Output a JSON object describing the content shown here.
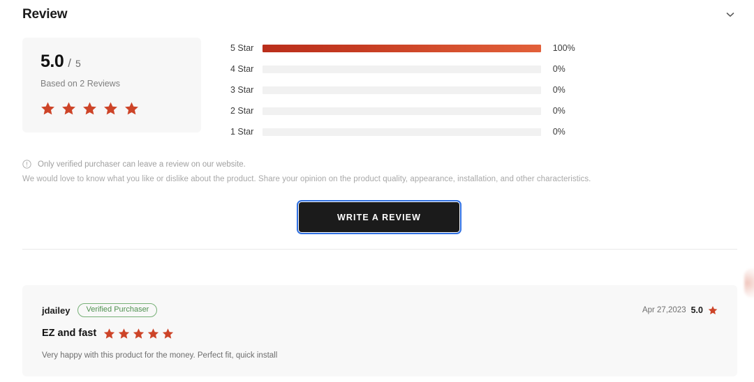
{
  "header": {
    "title": "Review",
    "collapse_icon": "chevron-down-icon"
  },
  "summary": {
    "score": "5.0",
    "separator": "/",
    "max_score": "5",
    "based_on": "Based on 2 Reviews",
    "star_count": 5,
    "star_color": "#cd4428"
  },
  "distribution": {
    "rows": [
      {
        "label": "5 Star",
        "percent": "100%",
        "value": 100
      },
      {
        "label": "4 Star",
        "percent": "0%",
        "value": 0
      },
      {
        "label": "3 Star",
        "percent": "0%",
        "value": 0
      },
      {
        "label": "2 Star",
        "percent": "0%",
        "value": 0
      },
      {
        "label": "1 Star",
        "percent": "0%",
        "value": 0
      }
    ],
    "track_color": "#f1f1f1",
    "fill_gradient_from": "#ba2e1b",
    "fill_gradient_to": "#e2603a"
  },
  "notice": {
    "icon": "info-circle-icon",
    "text": "Only verified purchaser can leave a review on our website.",
    "prompt": "We would love to know what you like or dislike about the product. Share your opinion on the product quality, appearance, installation, and other characteristics."
  },
  "actions": {
    "write_review_label": "WRITE A REVIEW",
    "button_background": "#1b1b1b",
    "focus_ring_color": "#2f6fe0"
  },
  "reviews": [
    {
      "author": "jdailey",
      "verified_badge": "Verified Purchaser",
      "date": "Apr 27,2023",
      "score": "5.0",
      "star_count": 5,
      "headline": "EZ and fast",
      "body": "Very happy with this product for the money. Perfect fit, quick install"
    }
  ]
}
